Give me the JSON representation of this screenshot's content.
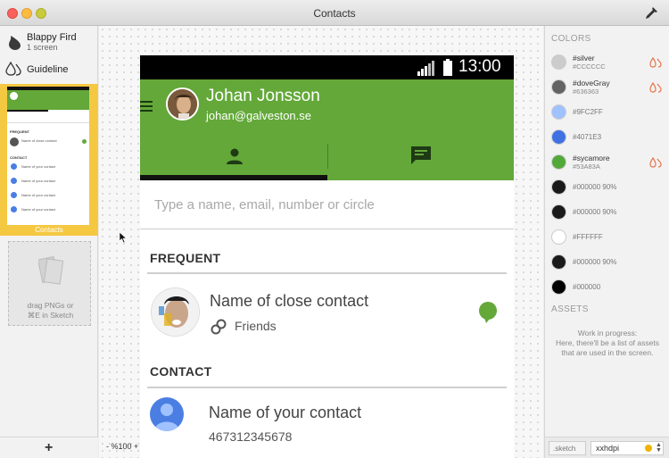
{
  "window": {
    "title": "Contacts"
  },
  "project": {
    "name": "Blappy Fird",
    "screens": "1 screen"
  },
  "guideline": {
    "label": "Guideline"
  },
  "artboard": {
    "label": "Contacts",
    "mini_frequent": "FREQUENT",
    "mini_contact": "CONTACT",
    "mini_row_1": "Name of close contact",
    "mini_row_2": "Name of your contact"
  },
  "dropzone": {
    "line1": "drag PNGs or",
    "line2": "⌘E in Sketch"
  },
  "canvas": {
    "zoom": "- %100 +"
  },
  "phone": {
    "time": "13:00",
    "user_name": "Johan Jonsson",
    "user_email": "johan@galveston.se",
    "search_placeholder": "Type a name, email, number or circle",
    "frequent_header": "FREQUENT",
    "contact_header": "CONTACT",
    "close_contact_name": "Name of close contact",
    "close_contact_circle": "Friends",
    "contact_name": "Name of your contact",
    "contact_number": "467312345678"
  },
  "colors_panel": {
    "header": "COLORS",
    "items": [
      {
        "name": "#silver",
        "hex": "#CCCCCC",
        "color": "#cccccc"
      },
      {
        "name": "#doveGray",
        "hex": "#636363",
        "color": "#636363"
      },
      {
        "name": "",
        "hex": "#9FC2FF",
        "color": "#9fc2ff"
      },
      {
        "name": "",
        "hex": "#4071E3",
        "color": "#4071e3"
      },
      {
        "name": "#sycamore",
        "hex": "#53A83A",
        "color": "#53a83a"
      },
      {
        "name": "",
        "hex": "#000000 90%",
        "color": "#1a1a1a"
      },
      {
        "name": "",
        "hex": "#000000 90%",
        "color": "#1a1a1a"
      },
      {
        "name": "",
        "hex": "#FFFFFF",
        "color": "#ffffff"
      },
      {
        "name": "",
        "hex": "#000000 90%",
        "color": "#1a1a1a"
      },
      {
        "name": "",
        "hex": "#000000",
        "color": "#000000"
      }
    ]
  },
  "assets_panel": {
    "header": "ASSETS",
    "line1": "Work in progress:",
    "line2": "Here, there'll be a list of assets",
    "line3": "that are used in the screen."
  },
  "export": {
    "extension_placeholder": ".sketch",
    "density": "xxhdpi"
  },
  "theme": {
    "accent_green": "#63a839",
    "artboard_yellow": "#f5c842"
  }
}
